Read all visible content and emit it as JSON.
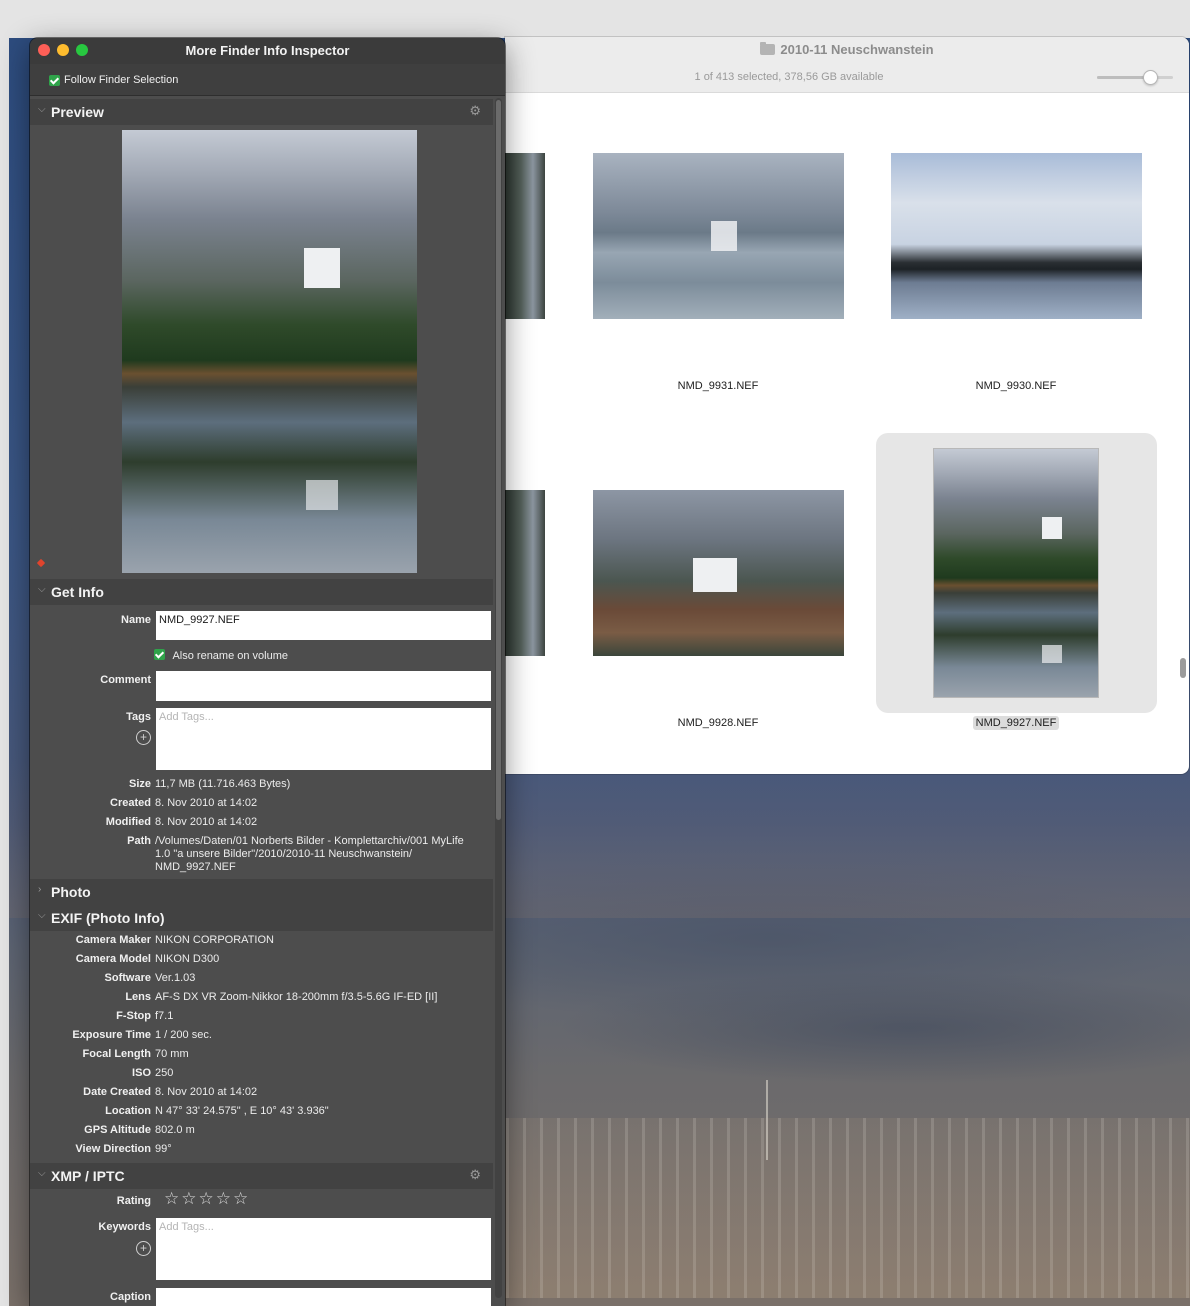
{
  "finder": {
    "title": "2010-11 Neuschwanstein",
    "status": "1 of 413 selected, 378,56 GB available",
    "zoom_level": 0.7,
    "items": [
      {
        "name": "NMD_9931.NEF",
        "selected": false
      },
      {
        "name": "NMD_9930.NEF",
        "selected": false
      },
      {
        "name": "NMD_9928.NEF",
        "selected": false
      },
      {
        "name": "NMD_9927.NEF",
        "selected": true
      }
    ]
  },
  "inspector": {
    "title": "More Finder Info Inspector",
    "follow_label": "Follow Finder Selection",
    "sections": {
      "preview": "Preview",
      "get_info": "Get Info",
      "photo": "Photo",
      "exif": "EXIF (Photo Info)",
      "xmp": "XMP / IPTC"
    },
    "get_info": {
      "name_label": "Name",
      "name_value": "NMD_9927.NEF",
      "rename_label": "Also rename on volume",
      "comment_label": "Comment",
      "comment_value": "",
      "tags_label": "Tags",
      "tags_placeholder": "Add Tags...",
      "size_label": "Size",
      "size_value": "11,7 MB (11.716.463 Bytes)",
      "created_label": "Created",
      "created_value": "8. Nov 2010 at 14:02",
      "modified_label": "Modified",
      "modified_value": "8. Nov 2010 at 14:02",
      "path_label": "Path",
      "path_line1": "/Volumes/Daten/01 Norberts Bilder - Komplettarchiv/001 MyLife",
      "path_line2": "1.0 \"a unsere Bilder\"/2010/2010-11 Neuschwanstein/",
      "path_line3": "NMD_9927.NEF"
    },
    "exif": [
      {
        "label": "Camera Maker",
        "value": "NIKON CORPORATION"
      },
      {
        "label": "Camera Model",
        "value": "NIKON D300"
      },
      {
        "label": "Software",
        "value": "Ver.1.03"
      },
      {
        "label": "Lens",
        "value": "AF-S DX VR Zoom-Nikkor 18-200mm f/3.5-5.6G IF-ED [II]"
      },
      {
        "label": "F-Stop",
        "value": "f7.1"
      },
      {
        "label": "Exposure Time",
        "value": "1 / 200 sec."
      },
      {
        "label": "Focal Length",
        "value": "70 mm"
      },
      {
        "label": "ISO",
        "value": "250"
      },
      {
        "label": "Date Created",
        "value": "8. Nov 2010 at 14:02"
      },
      {
        "label": "Location",
        "value": "N 47° 33' 24.575\" , E 10° 43' 3.936\""
      },
      {
        "label": "GPS Altitude",
        "value": "802.0 m"
      },
      {
        "label": "View Direction",
        "value": "99°"
      }
    ],
    "xmp": {
      "rating_label": "Rating",
      "rating_value": 0,
      "rating_stars": "☆☆☆☆☆",
      "keywords_label": "Keywords",
      "keywords_placeholder": "Add Tags...",
      "caption_label": "Caption"
    },
    "icons": {
      "gear": "⚙",
      "plus": "+",
      "chevron_down": "⌵",
      "chevron_right": "›"
    }
  }
}
